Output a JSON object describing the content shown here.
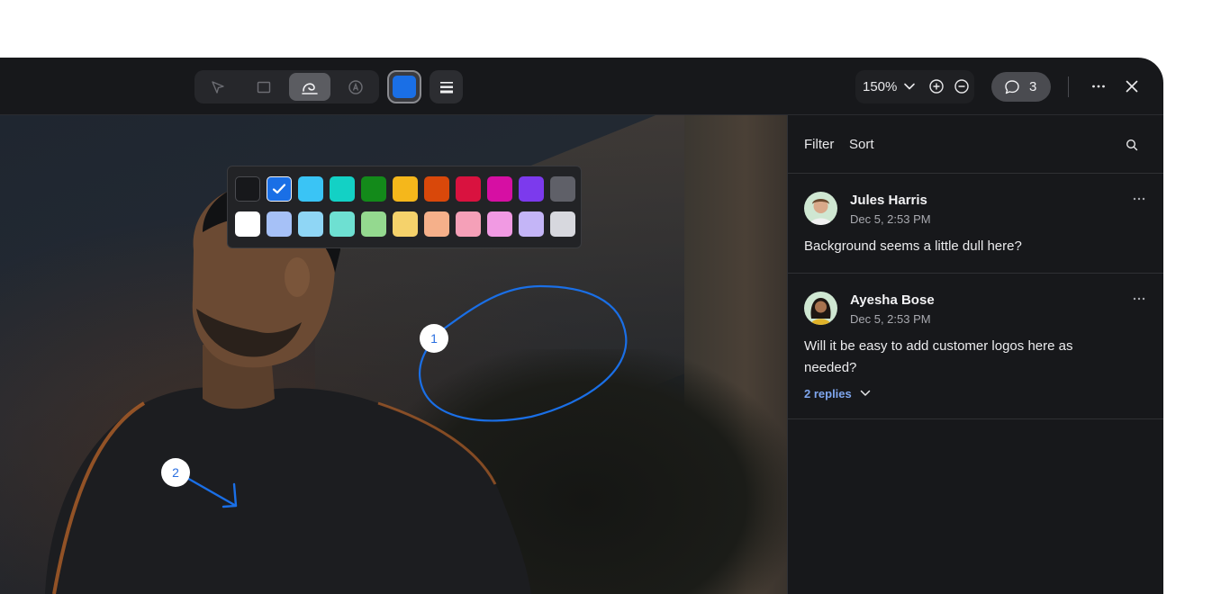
{
  "toolbar": {
    "tools": [
      {
        "name": "select",
        "icon": "cursor-icon",
        "active": false
      },
      {
        "name": "rectangle",
        "icon": "rectangle-icon",
        "active": false
      },
      {
        "name": "draw",
        "icon": "freehand-draw-icon",
        "active": true
      },
      {
        "name": "text",
        "icon": "text-circle-icon",
        "active": false
      }
    ],
    "current_color": "#1a6fe6",
    "zoom_label": "150%",
    "comment_count": "3"
  },
  "palette": {
    "row1": [
      "#17181b",
      "#1a6fe6",
      "#3ac4f5",
      "#13d1c5",
      "#138a1a",
      "#f5b71b",
      "#d9480a",
      "#d9123f",
      "#d60fa3",
      "#7c3aed",
      "#5f6068"
    ],
    "row2": [
      "#ffffff",
      "#a6c1f7",
      "#8fd6f5",
      "#6ee0d2",
      "#94d98f",
      "#f5d26b",
      "#f5b08a",
      "#f5a0b8",
      "#f19ae3",
      "#c4b5f7",
      "#d7d8de"
    ],
    "selected_index": 1
  },
  "canvas": {
    "pins": [
      "1",
      "2"
    ],
    "annotation_color": "#1a6fe6"
  },
  "panel": {
    "filter_label": "Filter",
    "sort_label": "Sort",
    "comments": [
      {
        "author": "Jules Harris",
        "date": "Dec 5, 2:53 PM",
        "body": "Background seems a little dull here?"
      },
      {
        "author": "Ayesha Bose",
        "date": "Dec 5, 2:53 PM",
        "body": "Will it be easy to add customer logos here as needed?",
        "replies_label": "2 replies"
      }
    ]
  }
}
